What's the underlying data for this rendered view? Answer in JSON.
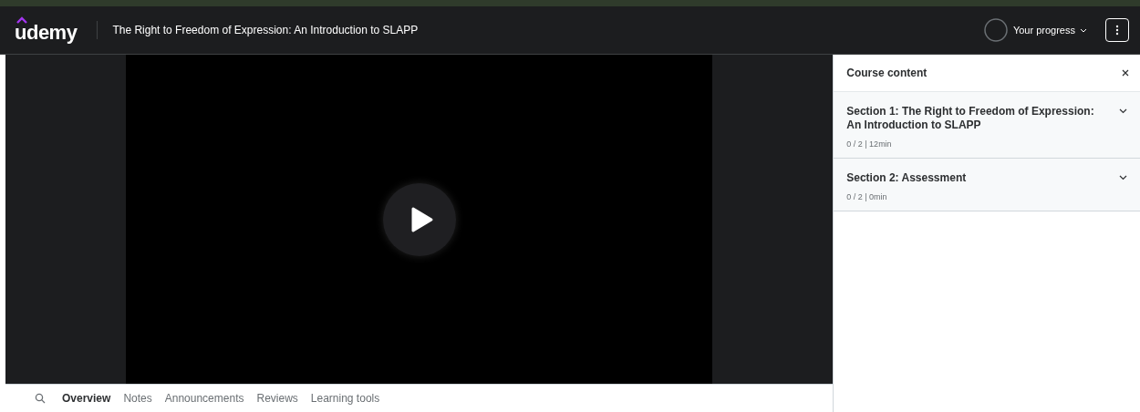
{
  "header": {
    "logo": "udemy",
    "course_title": "The Right to Freedom of Expression: An Introduction to SLAPP",
    "progress_label": "Your progress"
  },
  "tabs": [
    {
      "label": "Overview",
      "selected": true
    },
    {
      "label": "Notes",
      "selected": false
    },
    {
      "label": "Announcements",
      "selected": false
    },
    {
      "label": "Reviews",
      "selected": false
    },
    {
      "label": "Learning tools",
      "selected": false
    }
  ],
  "sidebar": {
    "title": "Course content",
    "sections": [
      {
        "title": "Section 1: The Right to Freedom of Expression: An Introduction to SLAPP",
        "meta": "0 / 2 | 12min",
        "expanded": false
      },
      {
        "title": "Section 2: Assessment",
        "meta": "0 / 2 | 0min",
        "expanded": false
      }
    ]
  }
}
